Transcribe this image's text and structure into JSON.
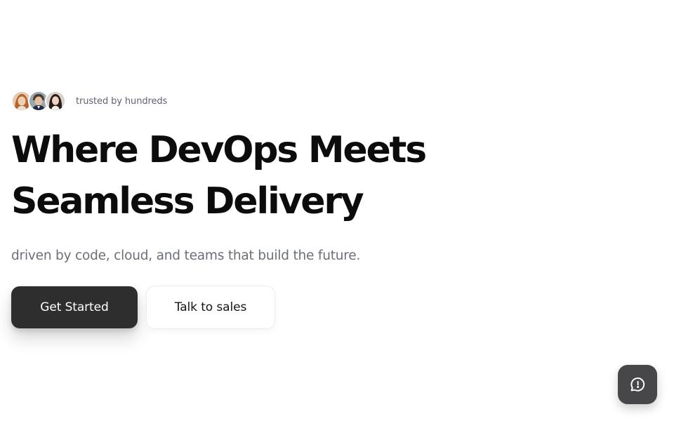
{
  "trust": {
    "text": "trusted by hundreds",
    "avatars": [
      "avatar-1",
      "avatar-2",
      "avatar-3"
    ]
  },
  "hero": {
    "headline_line1": "Where DevOps Meets",
    "headline_line2": "Seamless Delivery",
    "subtitle": "driven by code, cloud, and teams that build the future."
  },
  "actions": {
    "primary_label": "Get Started",
    "secondary_label": "Talk to sales"
  },
  "chat": {
    "icon": "chat-bubble-alert-icon"
  },
  "colors": {
    "primary_button": "#2e2e2f",
    "headline": "#0c0c0d",
    "subtitle": "#6b6f78",
    "chat_button": "#474749"
  }
}
